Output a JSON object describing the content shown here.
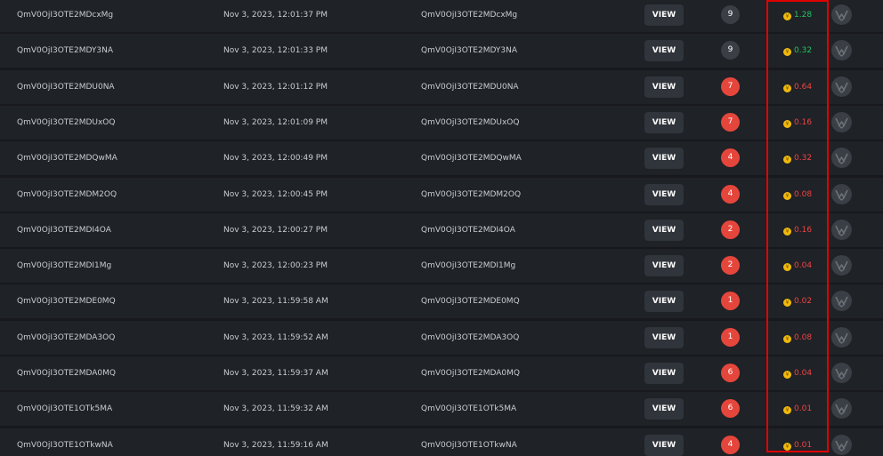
{
  "colors": {
    "badge_gray": "#3a3e45",
    "badge_red": "#e5463c",
    "price_green": "#22c55e",
    "price_red": "#ef4444",
    "highlight": "#e10000"
  },
  "rows": [
    {
      "name": "QmV0OjI3OTE2MDcxMg",
      "date": "Nov 3, 2023, 12:01:37 PM",
      "hash": "QmV0OjI3OTE2MDcxMg",
      "view_label": "VIEW",
      "count": "9",
      "count_status": "gray",
      "price": "1.28",
      "price_status": "green"
    },
    {
      "name": "QmV0OjI3OTE2MDY3NA",
      "date": "Nov 3, 2023, 12:01:33 PM",
      "hash": "QmV0OjI3OTE2MDY3NA",
      "view_label": "VIEW",
      "count": "9",
      "count_status": "gray",
      "price": "0.32",
      "price_status": "green"
    },
    {
      "name": "QmV0OjI3OTE2MDU0NA",
      "date": "Nov 3, 2023, 12:01:12 PM",
      "hash": "QmV0OjI3OTE2MDU0NA",
      "view_label": "VIEW",
      "count": "7",
      "count_status": "red",
      "price": "0.64",
      "price_status": "red"
    },
    {
      "name": "QmV0OjI3OTE2MDUxOQ",
      "date": "Nov 3, 2023, 12:01:09 PM",
      "hash": "QmV0OjI3OTE2MDUxOQ",
      "view_label": "VIEW",
      "count": "7",
      "count_status": "red",
      "price": "0.16",
      "price_status": "red"
    },
    {
      "name": "QmV0OjI3OTE2MDQwMA",
      "date": "Nov 3, 2023, 12:00:49 PM",
      "hash": "QmV0OjI3OTE2MDQwMA",
      "view_label": "VIEW",
      "count": "4",
      "count_status": "red",
      "price": "0.32",
      "price_status": "red"
    },
    {
      "name": "QmV0OjI3OTE2MDM2OQ",
      "date": "Nov 3, 2023, 12:00:45 PM",
      "hash": "QmV0OjI3OTE2MDM2OQ",
      "view_label": "VIEW",
      "count": "4",
      "count_status": "red",
      "price": "0.08",
      "price_status": "red"
    },
    {
      "name": "QmV0OjI3OTE2MDI4OA",
      "date": "Nov 3, 2023, 12:00:27 PM",
      "hash": "QmV0OjI3OTE2MDI4OA",
      "view_label": "VIEW",
      "count": "2",
      "count_status": "red",
      "price": "0.16",
      "price_status": "red"
    },
    {
      "name": "QmV0OjI3OTE2MDI1Mg",
      "date": "Nov 3, 2023, 12:00:23 PM",
      "hash": "QmV0OjI3OTE2MDI1Mg",
      "view_label": "VIEW",
      "count": "2",
      "count_status": "red",
      "price": "0.04",
      "price_status": "red"
    },
    {
      "name": "QmV0OjI3OTE2MDE0MQ",
      "date": "Nov 3, 2023, 11:59:58 AM",
      "hash": "QmV0OjI3OTE2MDE0MQ",
      "view_label": "VIEW",
      "count": "1",
      "count_status": "red",
      "price": "0.02",
      "price_status": "red"
    },
    {
      "name": "QmV0OjI3OTE2MDA3OQ",
      "date": "Nov 3, 2023, 11:59:52 AM",
      "hash": "QmV0OjI3OTE2MDA3OQ",
      "view_label": "VIEW",
      "count": "1",
      "count_status": "red",
      "price": "0.08",
      "price_status": "red"
    },
    {
      "name": "QmV0OjI3OTE2MDA0MQ",
      "date": "Nov 3, 2023, 11:59:37 AM",
      "hash": "QmV0OjI3OTE2MDA0MQ",
      "view_label": "VIEW",
      "count": "6",
      "count_status": "red",
      "price": "0.04",
      "price_status": "red"
    },
    {
      "name": "QmV0OjI3OTE1OTk5MA",
      "date": "Nov 3, 2023, 11:59:32 AM",
      "hash": "QmV0OjI3OTE1OTk5MA",
      "view_label": "VIEW",
      "count": "6",
      "count_status": "red",
      "price": "0.01",
      "price_status": "red"
    },
    {
      "name": "QmV0OjI3OTE1OTkwNA",
      "date": "Nov 3, 2023, 11:59:16 AM",
      "hash": "QmV0OjI3OTE1OTkwNA",
      "view_label": "VIEW",
      "count": "4",
      "count_status": "red",
      "price": "0.01",
      "price_status": "red"
    }
  ]
}
